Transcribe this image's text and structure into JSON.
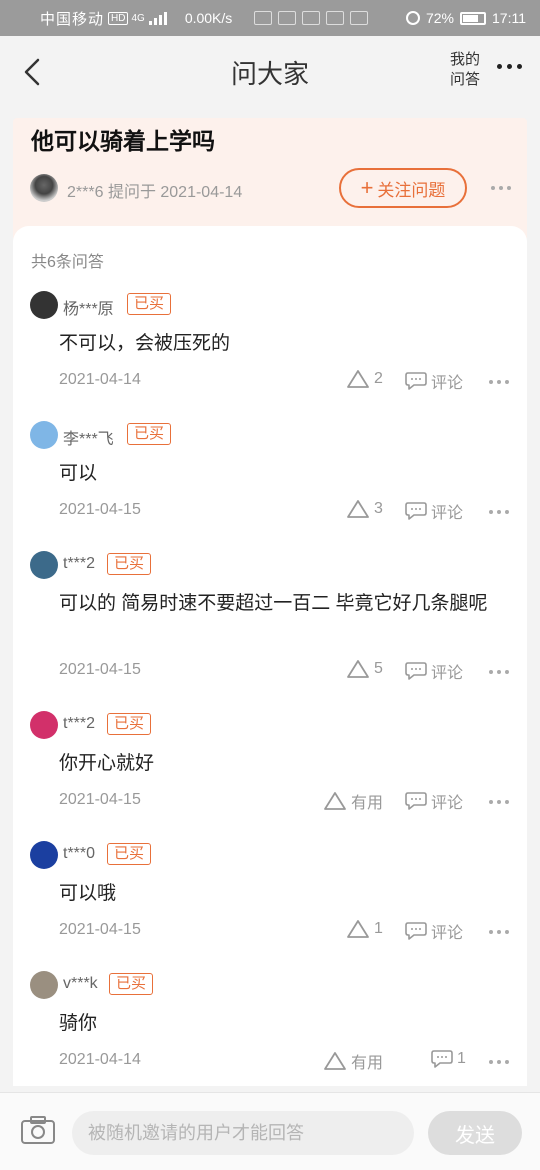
{
  "status_bar": {
    "carrier": "中国移动",
    "hd": "HD",
    "network": "4G",
    "speed": "0.00K/s",
    "battery": "72%",
    "time": "17:11"
  },
  "nav": {
    "title": "问大家",
    "my_qa_line1": "我的",
    "my_qa_line2": "问答"
  },
  "question": {
    "title": "他可以骑着上学吗",
    "asker": "2***6",
    "asked_label": "提问于 2021-04-14",
    "follow_label": "关注问题",
    "follow_icon": "plus-icon"
  },
  "answers_count": "共6条问答",
  "answers": [
    {
      "user": "杨***原",
      "badge": "已买",
      "content": "不可以，会被压死的",
      "date": "2021-04-14",
      "likes": "2",
      "comment": "评论",
      "avatar_color": "#333333"
    },
    {
      "user": "李***飞",
      "badge": "已买",
      "content": "可以",
      "date": "2021-04-15",
      "likes": "3",
      "comment": "评论",
      "avatar_color": "#7fb6e6"
    },
    {
      "user": "t***2",
      "badge": "已买",
      "content": "可以的 简易时速不要超过一百二  毕竟它好几条腿呢",
      "date": "2021-04-15",
      "likes": "5",
      "comment": "评论",
      "avatar_color": "#3c6a8a"
    },
    {
      "user": "t***2",
      "badge": "已买",
      "content": "你开心就好",
      "date": "2021-04-15",
      "likes": "有用",
      "comment": "评论",
      "avatar_color": "#d2306a"
    },
    {
      "user": "t***0",
      "badge": "已买",
      "content": "可以哦",
      "date": "2021-04-15",
      "likes": "1",
      "comment": "评论",
      "avatar_color": "#1b3fa0"
    },
    {
      "user": "v***k",
      "badge": "已买",
      "content": "骑你",
      "date": "2021-04-14",
      "likes": "有用",
      "comment": "1",
      "avatar_color": "#9a8f80"
    }
  ],
  "bottom": {
    "placeholder": "被随机邀请的用户才能回答",
    "send_label": "发送"
  }
}
